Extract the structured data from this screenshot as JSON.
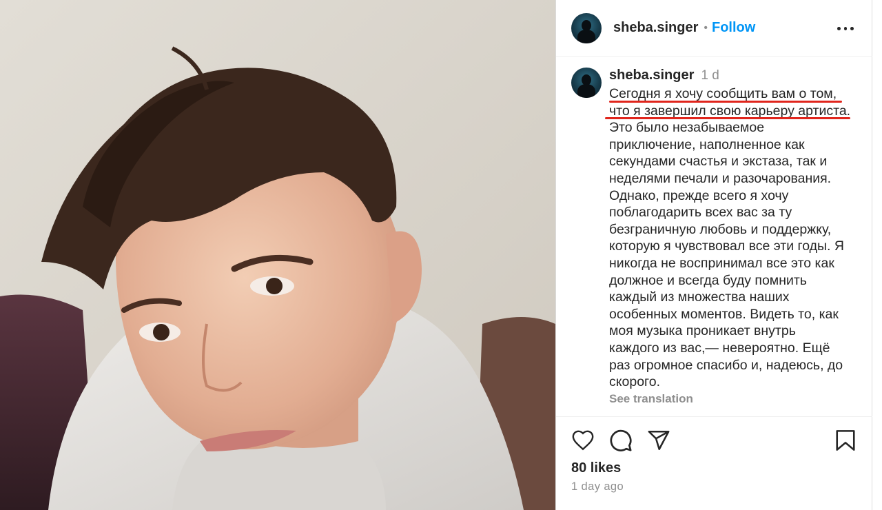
{
  "post": {
    "username": "sheba.singer",
    "follow_label": "Follow",
    "separator": "•"
  },
  "caption": {
    "username": "sheba.singer",
    "time": "1 d",
    "lines": [
      "Сегодня я хочу сообщить вам о том,",
      "что я завершил свою карьеру артиста.",
      "Это было незабываемое",
      "приключение, наполненное как",
      "секундами счастья и экстаза, так и",
      "неделями печали и разочарования.",
      "Однако, прежде всего я хочу",
      "поблагодарить всех вас за ту",
      "безграничную любовь и поддержку,",
      "которую я чувствовал все эти годы. Я",
      "никогда не воспринимал все это как",
      "должное и всегда буду помнить",
      "каждый из множества наших",
      "особенных моментов. Видеть то, как",
      "моя музыка проникает внутрь",
      "каждого из вас,— невероятно. Ещё",
      "раз огромное спасибо и, надеюсь, до",
      "скорого."
    ],
    "see_translation": "See translation",
    "highlight_color": "#e0251c"
  },
  "actions": {
    "icons": [
      "heart-icon",
      "comment-icon",
      "share-icon",
      "bookmark-icon"
    ],
    "likes": "80 likes",
    "date": "1 day ago"
  },
  "colors": {
    "link": "#0095f6",
    "muted": "#8e8e8e",
    "text": "#262626"
  }
}
